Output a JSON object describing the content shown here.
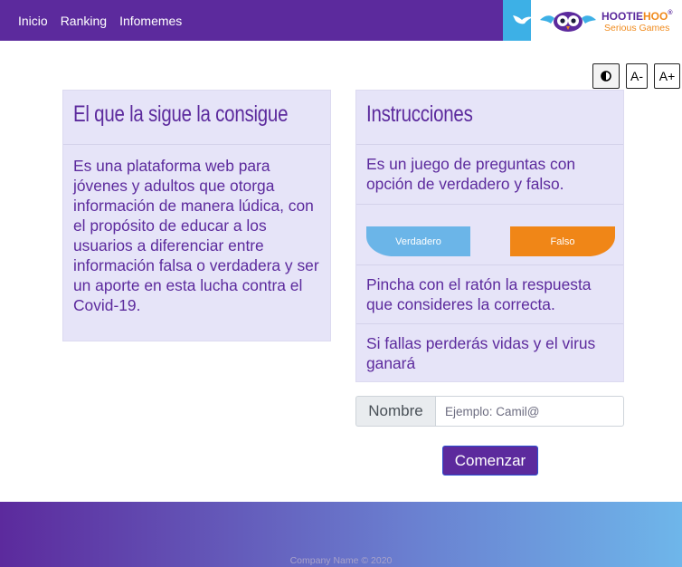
{
  "nav": {
    "links": [
      "Inicio",
      "Ranking",
      "Infomemes"
    ]
  },
  "logo": {
    "title_part1": "HOOTIE",
    "title_part2": "HOO",
    "registered": "®",
    "subtitle": "Serious Games"
  },
  "accessibility": {
    "contrast_icon": "contrast-icon",
    "decrease_label": "A-",
    "increase_label": "A+"
  },
  "about": {
    "title": "El que la sigue la consigue",
    "text": "Es una plataforma web para jóvenes y adultos que otorga información de manera lúdica, con el propósito de educar a los usuarios a diferenciar entre información falsa o verdadera y ser un aporte en esta lucha contra el Covid-19."
  },
  "instructions": {
    "title": "Instrucciones",
    "intro": "Es un juego de preguntas con opción de verdadero y falso.",
    "true_label": "Verdadero",
    "false_label": "Falso",
    "click_text": "Pincha con el ratón la respuesta que consideres la correcta.",
    "lose_text": "Si fallas perderás vidas y el virus ganará"
  },
  "form": {
    "name_label": "Nombre",
    "name_placeholder": "Ejemplo: Camil@",
    "name_value": "",
    "start_label": "Comenzar"
  },
  "footer": {
    "copyright": "Company Name © 2020"
  },
  "colors": {
    "brand_purple": "#5c2a9d",
    "accent_orange": "#f08617",
    "accent_blue": "#6bb5e8",
    "card_bg": "#e6e4f8"
  }
}
